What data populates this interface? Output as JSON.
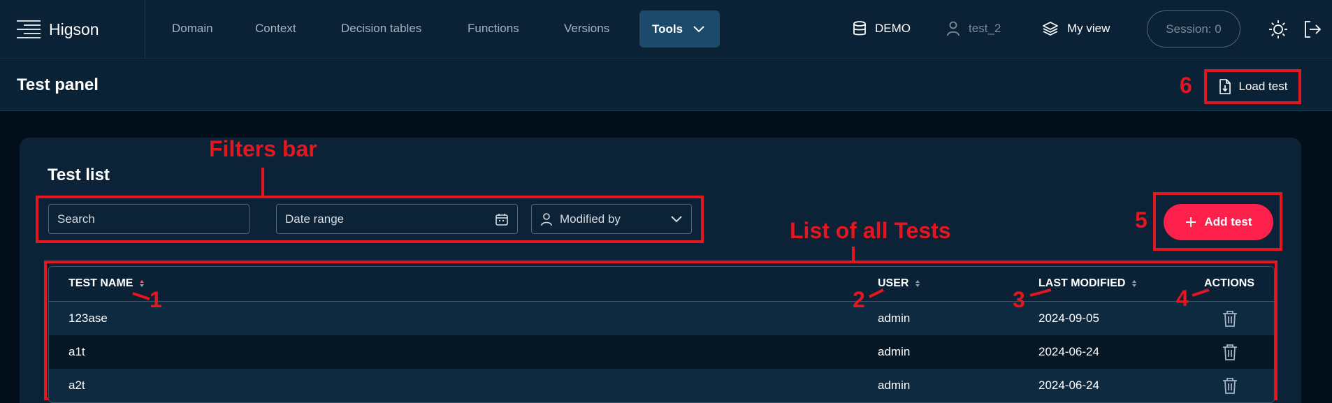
{
  "app": {
    "logo_text": "Higson"
  },
  "nav": {
    "items": [
      "Domain",
      "Context",
      "Decision tables",
      "Functions",
      "Versions"
    ],
    "tools_label": "Tools",
    "environment": "DEMO",
    "user": "test_2",
    "view": "My view",
    "session": "Session: 0"
  },
  "page": {
    "title": "Test panel",
    "load_test_label": "Load test"
  },
  "card": {
    "title": "Test list",
    "search_placeholder": "Search",
    "date_range_label": "Date range",
    "modified_by_label": "Modified by",
    "add_test_label": "Add test"
  },
  "table": {
    "columns": [
      "TEST NAME",
      "USER",
      "LAST MODIFIED",
      "ACTIONS"
    ],
    "rows": [
      {
        "name": "123ase",
        "user": "admin",
        "modified": "2024-09-05"
      },
      {
        "name": "a1t",
        "user": "admin",
        "modified": "2024-06-24"
      },
      {
        "name": "a2t",
        "user": "admin",
        "modified": "2024-06-24"
      }
    ]
  },
  "annotations": {
    "filters_bar": "Filters bar",
    "list_of_tests": "List of all Tests",
    "n1": "1",
    "n2": "2",
    "n3": "3",
    "n4": "4",
    "n5": "5",
    "n6": "6"
  },
  "colors": {
    "accent": "#ff1f4b",
    "annotation": "#e4161f",
    "nav_bg": "#0b2236",
    "page_bg": "#020f1a"
  }
}
